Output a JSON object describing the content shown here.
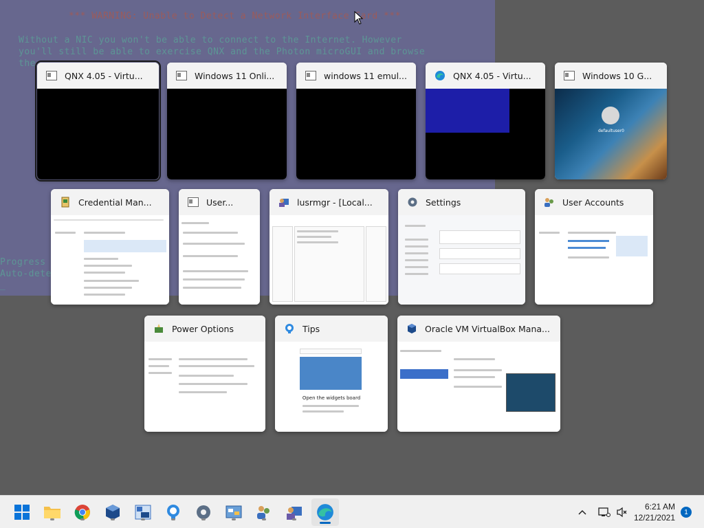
{
  "background_console": {
    "warning": "*** WARNING: Unable to Detect a Network Interface Card ***",
    "line1": "Without a NIC you won't be able to connect to the Internet. However",
    "line2": "you'll still be able to exercise QNX and the Photon microGUI and browse",
    "line3": "the",
    "line4": "Progress",
    "line5": "Auto-dete",
    "line6": "_"
  },
  "task_view": {
    "row1": [
      {
        "title": "QNX 4.05 - Virtu...",
        "icon": "virtual-machine-window-icon"
      },
      {
        "title": "Windows 11 Onli...",
        "icon": "virtual-machine-window-icon"
      },
      {
        "title": "windows 11 emul...",
        "icon": "virtual-machine-window-icon"
      },
      {
        "title": "QNX 4.05 - Virtu...",
        "icon": "edge-icon"
      },
      {
        "title": "Windows 10 G...",
        "icon": "virtual-machine-window-icon"
      }
    ],
    "row2": [
      {
        "title": "Credential Man...",
        "icon": "credential-manager-icon"
      },
      {
        "title": "User...",
        "icon": "user-accounts-window-icon"
      },
      {
        "title": "lusrmgr - [Local...",
        "icon": "lusrmgr-icon"
      },
      {
        "title": "Settings",
        "icon": "settings-gear-icon"
      },
      {
        "title": "User Accounts",
        "icon": "user-accounts-icon"
      }
    ],
    "row3": [
      {
        "title": "Power Options",
        "icon": "power-options-icon"
      },
      {
        "title": "Tips",
        "icon": "tips-icon"
      },
      {
        "title": "Oracle VM VirtualBox Mana...",
        "icon": "virtualbox-icon"
      }
    ],
    "win10_user": "defaultuser0",
    "tips_heading": "Open the widgets board"
  },
  "taskbar": {
    "pinned": [
      "start-icon",
      "file-explorer-icon",
      "chrome-icon",
      "virtualbox-icon",
      "winver-icon",
      "tips-icon",
      "settings-icon",
      "control-panel-icon",
      "user-accounts-icon",
      "lusrmgr-icon",
      "edge-icon"
    ],
    "time": "6:21 AM",
    "date": "12/21/2021",
    "notification_count": "1"
  },
  "colors": {
    "console_bg": "#8181c8",
    "console_text": "#6fd6d6",
    "console_warning": "#e06c6c",
    "accent": "#0067c0"
  }
}
